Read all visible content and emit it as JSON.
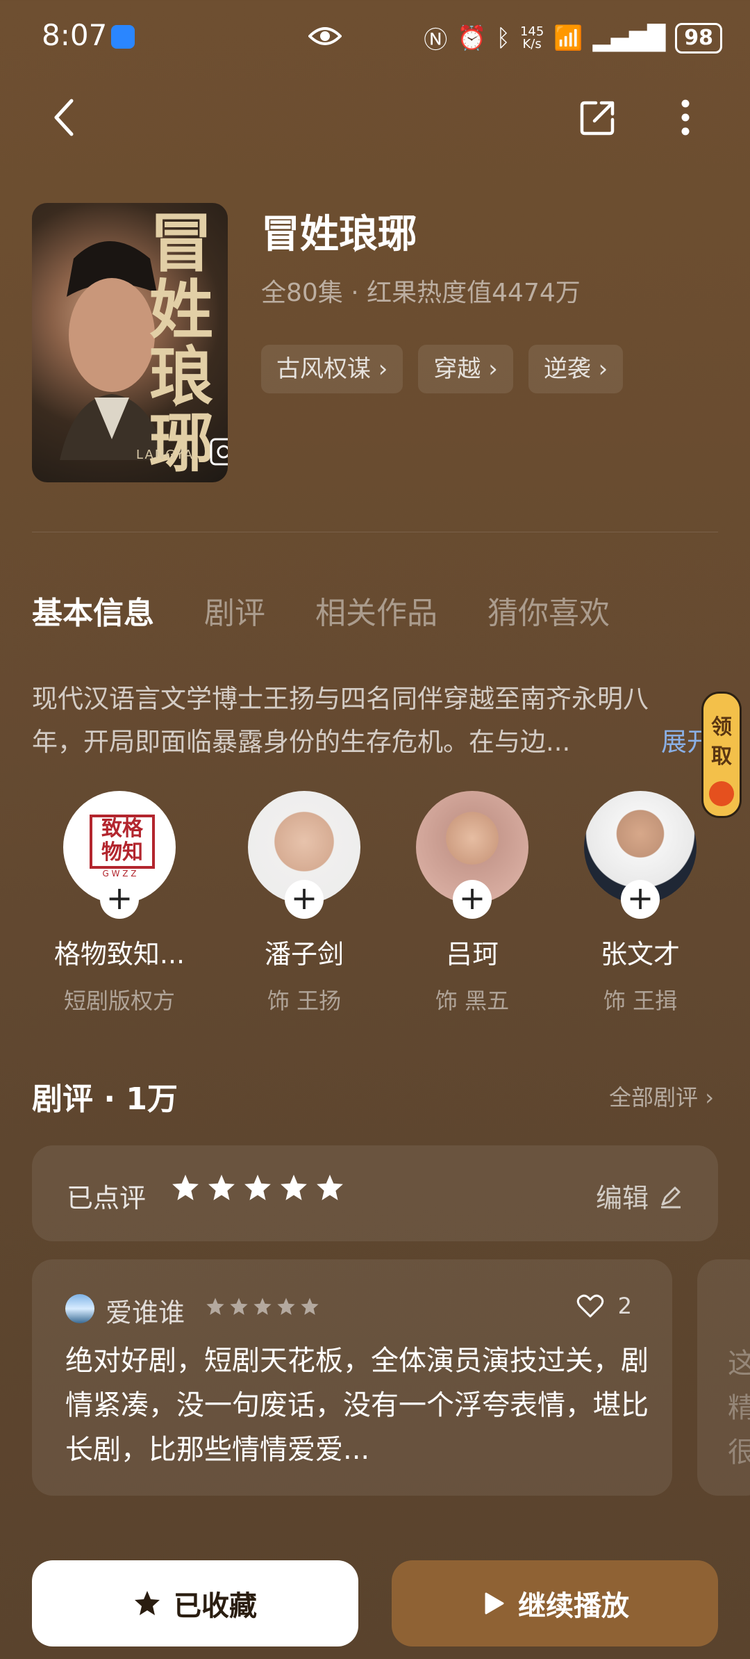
{
  "status_bar": {
    "time": "8:07",
    "net_speed_value": "145",
    "net_speed_unit": "K/s",
    "battery": "98"
  },
  "drama": {
    "title": "冒姓琅琊",
    "meta": "全80集 · 红果热度值4474万",
    "poster_title": "冒姓琅琊",
    "poster_caption": "LANGYA",
    "tags": [
      "古风权谋 ›",
      "穿越 ›",
      "逆袭 ›"
    ]
  },
  "tabs": [
    "基本信息",
    "剧评",
    "相关作品",
    "猜你喜欢"
  ],
  "synopsis": {
    "line1": "现代汉语言文学博士王扬与四名同伴穿越至南齐永明八",
    "line2": "年，开局即面临暴露身份的生存危机。在与边...",
    "expand_label": "展开"
  },
  "reward": {
    "label": "领取"
  },
  "cast": [
    {
      "name": "格物致知...",
      "role": "短剧版权方",
      "logo_text": "致格物知",
      "logo_sub": "G W Z Z"
    },
    {
      "name": "潘子剑",
      "role": "饰 王扬"
    },
    {
      "name": "吕珂",
      "role": "饰 黑五"
    },
    {
      "name": "张文才",
      "role": "饰 王揖"
    }
  ],
  "reviews": {
    "heading": "剧评 · 1万",
    "all_label": "全部剧评 ›",
    "my_rating_label": "已点评",
    "my_rating_stars": 5,
    "edit_label": "编辑",
    "items": [
      {
        "user": "爱谁谁",
        "stars": 5,
        "likes": "2",
        "text": "绝对好剧，短剧天花板，全体演员演技过关，剧情紧凑，没一句废话，没有一个浮夸表情，堪比长剧，比那些情情爱爱..."
      },
      {
        "text_partial": "这精很"
      }
    ]
  },
  "bottom": {
    "favorite_label": "已收藏",
    "play_label": "继续播放"
  },
  "colors": {
    "accent_play": "#8f6234",
    "link_blue": "#8ab0e6",
    "reward_yellow": "#f3c04a"
  }
}
